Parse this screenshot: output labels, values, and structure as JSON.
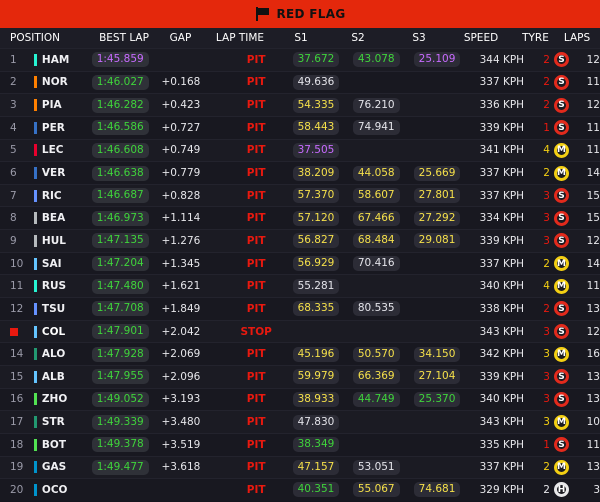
{
  "banner": {
    "title": "RED FLAG"
  },
  "columns": {
    "position": "POSITION",
    "best_lap": "BEST LAP",
    "gap": "GAP",
    "lap_time": "LAP TIME",
    "s1": "S1",
    "s2": "S2",
    "s3": "S3",
    "speed": "SPEED",
    "tyre": "TYRE",
    "laps": "LAPS"
  },
  "colors": {
    "red_flag": "#e4280c",
    "sector_personal_best": "#3fd43b",
    "sector_overall_best": "#c86bff",
    "sector_normal": "#f5e04a",
    "pit_text": "#e8190f"
  },
  "rows": [
    {
      "pos": "1",
      "team": "#27f4d2",
      "driver": "HAM",
      "best": "1:45.859",
      "best_c": "purple",
      "gap": "",
      "lap": "PIT",
      "s1": "37.672",
      "s1c": "green",
      "s2": "43.078",
      "s2c": "green",
      "s3": "25.109",
      "s3c": "purple",
      "speed": "344 KPH",
      "stint": "2",
      "stint_c": "#e8190f",
      "tyre": "S",
      "laps": "12"
    },
    {
      "pos": "2",
      "team": "#ff8000",
      "driver": "NOR",
      "best": "1:46.027",
      "best_c": "green",
      "gap": "+0.168",
      "lap": "PIT",
      "s1": "49.636",
      "s1c": "white",
      "s2": "",
      "s2c": "",
      "s3": "",
      "s3c": "",
      "speed": "337 KPH",
      "stint": "2",
      "stint_c": "#e8190f",
      "tyre": "S",
      "laps": "11"
    },
    {
      "pos": "3",
      "team": "#ff8000",
      "driver": "PIA",
      "best": "1:46.282",
      "best_c": "green",
      "gap": "+0.423",
      "lap": "PIT",
      "s1": "54.335",
      "s1c": "yellow",
      "s2": "76.210",
      "s2c": "white",
      "s3": "",
      "s3c": "",
      "speed": "336 KPH",
      "stint": "2",
      "stint_c": "#e8190f",
      "tyre": "S",
      "laps": "12"
    },
    {
      "pos": "4",
      "team": "#3671c6",
      "driver": "PER",
      "best": "1:46.586",
      "best_c": "green",
      "gap": "+0.727",
      "lap": "PIT",
      "s1": "58.443",
      "s1c": "yellow",
      "s2": "74.941",
      "s2c": "white",
      "s3": "",
      "s3c": "",
      "speed": "339 KPH",
      "stint": "1",
      "stint_c": "#e8190f",
      "tyre": "S",
      "laps": "11"
    },
    {
      "pos": "5",
      "team": "#e8002d",
      "driver": "LEC",
      "best": "1:46.608",
      "best_c": "green",
      "gap": "+0.749",
      "lap": "PIT",
      "s1": "37.505",
      "s1c": "purple",
      "s2": "",
      "s2c": "",
      "s3": "",
      "s3c": "",
      "speed": "341 KPH",
      "stint": "4",
      "stint_c": "#f3cf13",
      "tyre": "M",
      "laps": "11"
    },
    {
      "pos": "6",
      "team": "#3671c6",
      "driver": "VER",
      "best": "1:46.638",
      "best_c": "green",
      "gap": "+0.779",
      "lap": "PIT",
      "s1": "38.209",
      "s1c": "yellow",
      "s2": "44.058",
      "s2c": "yellow",
      "s3": "25.669",
      "s3c": "yellow",
      "speed": "337 KPH",
      "stint": "2",
      "stint_c": "#f3cf13",
      "tyre": "M",
      "laps": "14"
    },
    {
      "pos": "7",
      "team": "#6692ff",
      "driver": "RIC",
      "best": "1:46.687",
      "best_c": "green",
      "gap": "+0.828",
      "lap": "PIT",
      "s1": "57.370",
      "s1c": "yellow",
      "s2": "58.607",
      "s2c": "yellow",
      "s3": "27.801",
      "s3c": "yellow",
      "speed": "337 KPH",
      "stint": "3",
      "stint_c": "#e8190f",
      "tyre": "S",
      "laps": "15"
    },
    {
      "pos": "8",
      "team": "#b6babd",
      "driver": "BEA",
      "best": "1:46.973",
      "best_c": "green",
      "gap": "+1.114",
      "lap": "PIT",
      "s1": "57.120",
      "s1c": "yellow",
      "s2": "67.466",
      "s2c": "yellow",
      "s3": "27.292",
      "s3c": "yellow",
      "speed": "334 KPH",
      "stint": "3",
      "stint_c": "#e8190f",
      "tyre": "S",
      "laps": "15"
    },
    {
      "pos": "9",
      "team": "#b6babd",
      "driver": "HUL",
      "best": "1:47.135",
      "best_c": "green",
      "gap": "+1.276",
      "lap": "PIT",
      "s1": "56.827",
      "s1c": "yellow",
      "s2": "68.484",
      "s2c": "yellow",
      "s3": "29.081",
      "s3c": "yellow",
      "speed": "339 KPH",
      "stint": "3",
      "stint_c": "#e8190f",
      "tyre": "S",
      "laps": "12"
    },
    {
      "pos": "10",
      "team": "#64c4ff",
      "driver": "SAI",
      "best": "1:47.204",
      "best_c": "green",
      "gap": "+1.345",
      "lap": "PIT",
      "s1": "56.929",
      "s1c": "yellow",
      "s2": "70.416",
      "s2c": "white",
      "s3": "",
      "s3c": "",
      "speed": "337 KPH",
      "stint": "2",
      "stint_c": "#f3cf13",
      "tyre": "M",
      "laps": "14"
    },
    {
      "pos": "11",
      "team": "#27f4d2",
      "driver": "RUS",
      "best": "1:47.480",
      "best_c": "green",
      "gap": "+1.621",
      "lap": "PIT",
      "s1": "55.281",
      "s1c": "white",
      "s2": "",
      "s2c": "",
      "s3": "",
      "s3c": "",
      "speed": "340 KPH",
      "stint": "4",
      "stint_c": "#f3cf13",
      "tyre": "M",
      "laps": "11"
    },
    {
      "pos": "12",
      "team": "#6692ff",
      "driver": "TSU",
      "best": "1:47.708",
      "best_c": "green",
      "gap": "+1.849",
      "lap": "PIT",
      "s1": "68.335",
      "s1c": "yellow",
      "s2": "80.535",
      "s2c": "white",
      "s3": "",
      "s3c": "",
      "speed": "338 KPH",
      "stint": "2",
      "stint_c": "#e8190f",
      "tyre": "S",
      "laps": "13"
    },
    {
      "pos": "",
      "team": "#64c4ff",
      "driver": "COL",
      "best": "1:47.901",
      "best_c": "green",
      "gap": "+2.042",
      "lap": "STOP",
      "s1": "",
      "s1c": "",
      "s2": "",
      "s2c": "",
      "s3": "",
      "s3c": "",
      "speed": "343 KPH",
      "stint": "3",
      "stint_c": "#e8190f",
      "tyre": "S",
      "laps": "12",
      "stopped": true
    },
    {
      "pos": "14",
      "team": "#229971",
      "driver": "ALO",
      "best": "1:47.928",
      "best_c": "green",
      "gap": "+2.069",
      "lap": "PIT",
      "s1": "45.196",
      "s1c": "yellow",
      "s2": "50.570",
      "s2c": "yellow",
      "s3": "34.150",
      "s3c": "yellow",
      "speed": "342 KPH",
      "stint": "3",
      "stint_c": "#f3cf13",
      "tyre": "M",
      "laps": "16"
    },
    {
      "pos": "15",
      "team": "#64c4ff",
      "driver": "ALB",
      "best": "1:47.955",
      "best_c": "green",
      "gap": "+2.096",
      "lap": "PIT",
      "s1": "59.979",
      "s1c": "yellow",
      "s2": "66.369",
      "s2c": "yellow",
      "s3": "27.104",
      "s3c": "yellow",
      "speed": "339 KPH",
      "stint": "3",
      "stint_c": "#e8190f",
      "tyre": "S",
      "laps": "13"
    },
    {
      "pos": "16",
      "team": "#52e252",
      "driver": "ZHO",
      "best": "1:49.052",
      "best_c": "green",
      "gap": "+3.193",
      "lap": "PIT",
      "s1": "38.933",
      "s1c": "yellow",
      "s2": "44.749",
      "s2c": "green",
      "s3": "25.370",
      "s3c": "green",
      "speed": "340 KPH",
      "stint": "3",
      "stint_c": "#e8190f",
      "tyre": "S",
      "laps": "13"
    },
    {
      "pos": "17",
      "team": "#229971",
      "driver": "STR",
      "best": "1:49.339",
      "best_c": "green",
      "gap": "+3.480",
      "lap": "PIT",
      "s1": "47.830",
      "s1c": "white",
      "s2": "",
      "s2c": "",
      "s3": "",
      "s3c": "",
      "speed": "343 KPH",
      "stint": "3",
      "stint_c": "#f3cf13",
      "tyre": "M",
      "laps": "10"
    },
    {
      "pos": "18",
      "team": "#52e252",
      "driver": "BOT",
      "best": "1:49.378",
      "best_c": "green",
      "gap": "+3.519",
      "lap": "PIT",
      "s1": "38.349",
      "s1c": "green",
      "s2": "",
      "s2c": "",
      "s3": "",
      "s3c": "",
      "speed": "335 KPH",
      "stint": "1",
      "stint_c": "#e8190f",
      "tyre": "S",
      "laps": "11"
    },
    {
      "pos": "19",
      "team": "#0093cc",
      "driver": "GAS",
      "best": "1:49.477",
      "best_c": "green",
      "gap": "+3.618",
      "lap": "PIT",
      "s1": "47.157",
      "s1c": "yellow",
      "s2": "53.051",
      "s2c": "white",
      "s3": "",
      "s3c": "",
      "speed": "337 KPH",
      "stint": "2",
      "stint_c": "#f3cf13",
      "tyre": "M",
      "laps": "13"
    },
    {
      "pos": "20",
      "team": "#0093cc",
      "driver": "OCO",
      "best": "",
      "best_c": "",
      "gap": "",
      "lap": "PIT",
      "s1": "40.351",
      "s1c": "green",
      "s2": "55.067",
      "s2c": "yellow",
      "s3": "74.681",
      "s3c": "yellow",
      "speed": "329 KPH",
      "stint": "2",
      "stint_c": "#e6e6ea",
      "tyre": "H",
      "laps": "3"
    }
  ]
}
